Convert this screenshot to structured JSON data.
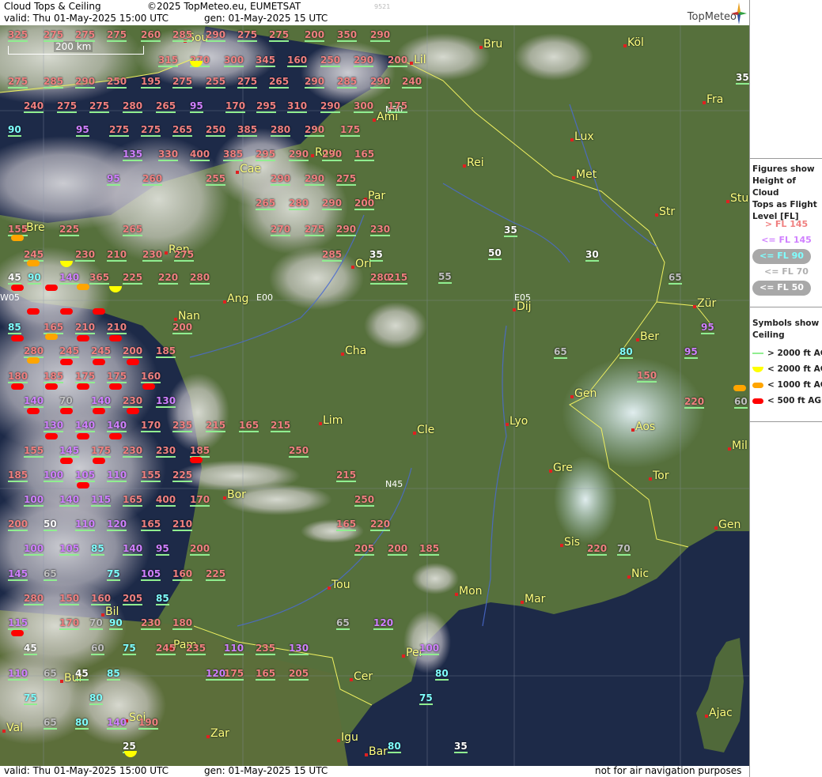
{
  "header": {
    "title": "Cloud Tops & Ceiling",
    "copyright": "©2025 TopMeteo.eu, EUMETSAT",
    "valid": "valid:  Thu  01-May-2025  15:00 UTC",
    "gen": "gen: 01-May-2025 15 UTC",
    "code": "9521",
    "brand": "TopMeteo"
  },
  "footer": {
    "valid": "valid:  Thu  01-May-2025  15:00 UTC",
    "gen": "gen: 01-May-2025 15 UTC",
    "disclaimer": "not for air navigation purposes"
  },
  "scale_bar": "200 km",
  "legend": {
    "title": "Figures show Height of Cloud Tops as Flight Level  [FL]",
    "title_lines": [
      "Figures show",
      "Height of Cloud",
      "Tops as Flight",
      "Level  [FL]"
    ],
    "items": [
      {
        "label": "> FL 145",
        "color": "#f08080"
      },
      {
        "label": "<= FL 145",
        "color": "#d080ff"
      },
      {
        "label": "<= FL 90",
        "color": "#7fffff"
      },
      {
        "label": "<= FL 70",
        "color": "#b0b0b0"
      },
      {
        "label": "<= FL 50",
        "color": "#ffffff"
      }
    ]
  },
  "symbols": {
    "title_lines": [
      "Symbols show",
      "Ceiling"
    ],
    "items": [
      {
        "label": "> 2000 ft AGL",
        "color": "#90ee90",
        "shape": "line"
      },
      {
        "label": "< 2000 ft AGL",
        "color": "#ffff00",
        "shape": "half-disc"
      },
      {
        "label": "< 1000 ft AGL",
        "color": "#ffa500",
        "shape": "pill"
      },
      {
        "label": "< 500 ft AGL",
        "color": "#ff0000",
        "shape": "pill"
      }
    ]
  },
  "cities": [
    "Bru",
    "Köl",
    "Sou",
    "Lil",
    "Fra",
    "Ami",
    "Lux",
    "Rou",
    "Cae",
    "Rei",
    "Met",
    "Stu",
    "Par",
    "Str",
    "Bre",
    "Ren",
    "Orl",
    "Ang",
    "Nan",
    "Dij",
    "Zür",
    "Cha",
    "Ber",
    "Gen",
    "Lim",
    "Cle",
    "Lyo",
    "Aos",
    "Mil",
    "Gre",
    "Tor",
    "Bor",
    "Sis",
    "Nic",
    "Gen",
    "Mon",
    "Mar",
    "Tou",
    "Bil",
    "Pam",
    "Per",
    "Cer",
    "Bur",
    "Soi",
    "Ajac",
    "Val",
    "Zar",
    "Igu",
    "Bar"
  ],
  "markers": [
    "E00",
    "E05",
    "N45",
    "N50",
    "W05"
  ],
  "cloud_tops": [
    "325",
    "275",
    "275",
    "275",
    "260",
    "285",
    "290",
    "275",
    "275",
    "200",
    "350",
    "290",
    "315",
    "270",
    "300",
    "345",
    "160",
    "250",
    "290",
    "200",
    "275",
    "285",
    "290",
    "250",
    "195",
    "275",
    "255",
    "275",
    "265",
    "290",
    "285",
    "290",
    "240",
    "240",
    "275",
    "275",
    "280",
    "265",
    "95",
    "170",
    "295",
    "310",
    "290",
    "300",
    "175",
    "90",
    "95",
    "275",
    "275",
    "265",
    "250",
    "385",
    "280",
    "290",
    "175",
    "135",
    "330",
    "400",
    "385",
    "295",
    "290",
    "290",
    "165",
    "95",
    "260",
    "255",
    "290",
    "290",
    "275",
    "265",
    "280",
    "290",
    "200",
    "155",
    "225",
    "265",
    "270",
    "275",
    "290",
    "230",
    "245",
    "230",
    "210",
    "230",
    "275",
    "285",
    "35",
    "45",
    "90",
    "140",
    "365",
    "225",
    "220",
    "280",
    "280",
    "215",
    "85",
    "165",
    "210",
    "210",
    "200",
    "280",
    "245",
    "245",
    "200",
    "185",
    "180",
    "185",
    "175",
    "175",
    "160",
    "140",
    "70",
    "140",
    "230",
    "130",
    "130",
    "140",
    "140",
    "170",
    "235",
    "215",
    "165",
    "215",
    "155",
    "145",
    "175",
    "230",
    "230",
    "185",
    "250",
    "185",
    "100",
    "105",
    "110",
    "155",
    "225",
    "215",
    "100",
    "140",
    "115",
    "165",
    "400",
    "170",
    "250",
    "200",
    "50",
    "110",
    "120",
    "165",
    "210",
    "165",
    "220",
    "100",
    "105",
    "85",
    "140",
    "95",
    "200",
    "205",
    "200",
    "185",
    "145",
    "65",
    "75",
    "105",
    "160",
    "225",
    "280",
    "150",
    "160",
    "205",
    "85",
    "115",
    "170",
    "70",
    "90",
    "230",
    "180",
    "65",
    "120",
    "45",
    "60",
    "75",
    "245",
    "235",
    "110",
    "235",
    "130",
    "100",
    "110",
    "65",
    "45",
    "85",
    "120",
    "175",
    "165",
    "205",
    "80",
    "75",
    "80",
    "75",
    "65",
    "80",
    "140",
    "190",
    "25",
    "80",
    "35",
    "35",
    "35",
    "50",
    "30",
    "55",
    "65",
    "95",
    "65",
    "80",
    "95",
    "150",
    "220",
    "70",
    "220",
    "60"
  ]
}
